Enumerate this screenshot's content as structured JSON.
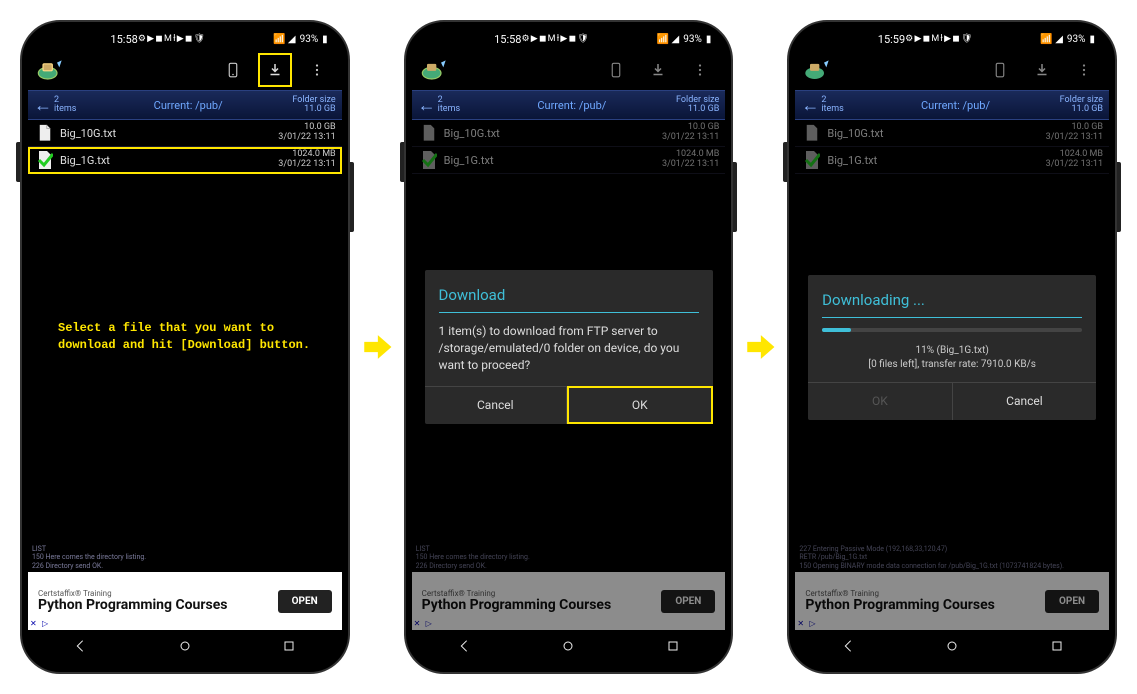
{
  "status": {
    "time1": "15:58",
    "time3": "15:59",
    "battery": "93%",
    "icons_mid": "⚙ ▶ ◼ M ł ▶ ◼ 🛡",
    "icons_right": "📶 ◢"
  },
  "toolbar": {},
  "path": {
    "count_n": "2",
    "count_label": "items",
    "current": "Current: /pub/",
    "folder_label": "Folder size",
    "folder_size": "11.0 GB"
  },
  "files": [
    {
      "name": "Big_10G.txt",
      "size": "10.0 GB",
      "date": "3/01/22 13:11"
    },
    {
      "name": "Big_1G.txt",
      "size": "1024.0 MB",
      "date": "3/01/22 13:11"
    }
  ],
  "instruction": "Select a file that you want to download and hit [Download] button.",
  "log1": {
    "l1": "LIST",
    "l2": "150 Here comes the directory listing.",
    "l3": "226 Directory send OK."
  },
  "log2": {
    "l1": "LIST",
    "l2": "150 Here comes the directory listing.",
    "l3": "226 Directory send OK."
  },
  "log3": {
    "l1": "227 Entering Passive Mode (192,168,33,120,47)",
    "l2": "RETR /pub/Big_1G.txt",
    "l3": "150 Opening BINARY mode data connection for /pub/Big_1G.txt (1073741824 bytes)."
  },
  "ad": {
    "brand": "Certstaffix® Training",
    "title": "Python Programming Courses",
    "open": "OPEN"
  },
  "dialog_confirm": {
    "title": "Download",
    "body": "1 item(s) to download from FTP server to /storage/emulated/0 folder on device, do you want to proceed?",
    "cancel": "Cancel",
    "ok": "OK"
  },
  "dialog_progress": {
    "title": "Downloading ...",
    "percent": 11,
    "line1": "11% (Big_1G.txt)",
    "line2": "[0 files left], transfer rate: 7910.0 KB/s",
    "ok": "OK",
    "cancel": "Cancel"
  }
}
